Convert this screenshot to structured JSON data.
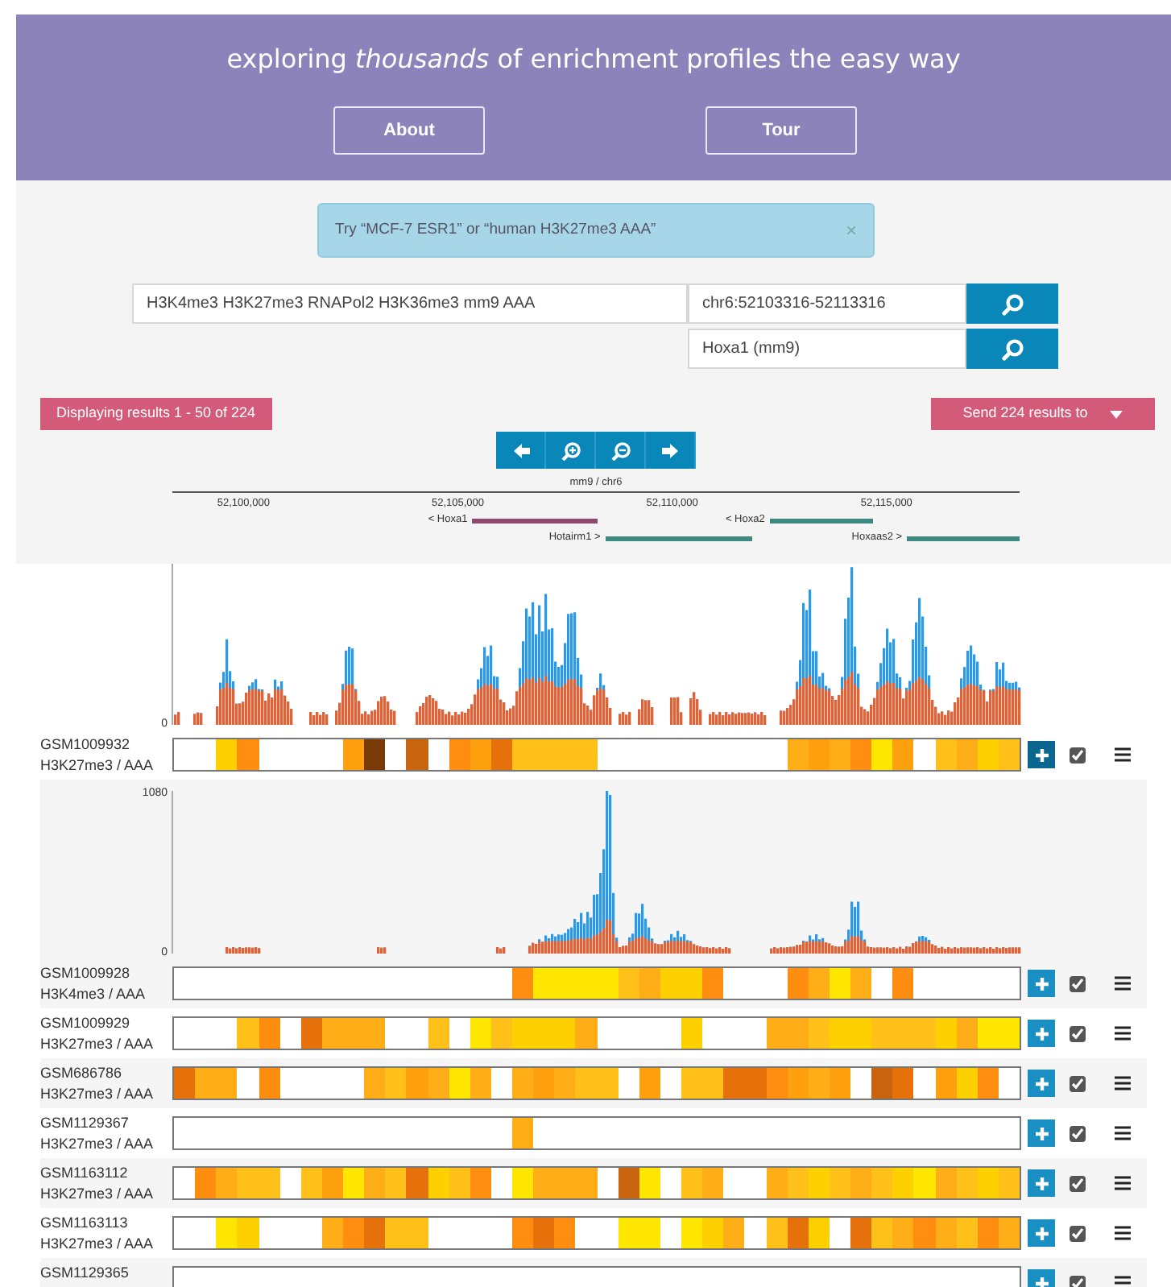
{
  "header": {
    "tagline": "exploring *thousands* of enrichment profiles the easy way",
    "buttons": [
      "About",
      "Tour"
    ]
  },
  "alert": {
    "text": "Try “MCF-7 ESR1” or “human H3K27me3 AAA”",
    "close": "×"
  },
  "search": {
    "query": "H3K4me3 H3K27me3 RNAPol2 H3K36me3 mm9 AAA",
    "location": "chr6:52103316-52113316",
    "gene": "Hoxa1 (mm9)"
  },
  "results_badge": "Displaying results 1 - 50 of 224",
  "send_button": "Send 224 results to",
  "genome_browser": {
    "assembly": "mm9 / chr6",
    "ticks": [
      "52,100,000",
      "52,105,000",
      "52,110,000",
      "52,115,000"
    ],
    "genes": [
      {
        "label": "< Hoxa1",
        "color": "#8b4a6e"
      },
      {
        "label": "< Hoxa2",
        "color": "#3f8a80"
      },
      {
        "label": "Hotairm1 >",
        "color": "#3f8a80"
      },
      {
        "label": "Hoxaas2 >",
        "color": "#3f8a80"
      }
    ]
  },
  "rows": [
    {
      "id": "GSM1009932",
      "mark": "H3K27me3 / AAA",
      "highlighted": true,
      "checked": true,
      "track": {
        "ymin": "0"
      },
      "cells": [
        null,
        null,
        {
          "color": "#ffd000"
        },
        {
          "color": "#ff8e10"
        },
        null,
        null,
        null,
        null,
        {
          "color": "#ffa00e"
        },
        {
          "color": "#7a3a08"
        },
        null,
        {
          "color": "#c8640e"
        },
        null,
        {
          "color": "#ff8e10"
        },
        {
          "color": "#ffa00e"
        },
        {
          "color": "#e6700a"
        },
        {
          "color": "#ffc01a"
        },
        {
          "color": "#ffc01a"
        },
        {
          "color": "#ffc01a"
        },
        {
          "color": "#ffc01a"
        },
        null,
        null,
        null,
        null,
        null,
        null,
        null,
        null,
        null,
        {
          "color": "#ffae18"
        },
        {
          "color": "#ffa00e"
        },
        {
          "color": "#ffae18"
        },
        {
          "color": "#ff8e10"
        },
        {
          "color": "#ffe600"
        },
        {
          "color": "#ffa00e"
        },
        null,
        {
          "color": "#ffc01a"
        },
        {
          "color": "#ffae18"
        },
        {
          "color": "#ffd000"
        },
        {
          "color": "#ffc01a"
        }
      ]
    },
    {
      "id": "GSM1009928",
      "mark": "H3K4me3 / AAA",
      "highlighted": false,
      "checked": true,
      "track": {
        "ymax": "1080",
        "ymin": "0"
      },
      "cells": [
        null,
        null,
        null,
        null,
        null,
        null,
        null,
        null,
        null,
        null,
        null,
        null,
        null,
        null,
        null,
        null,
        {
          "color": "#ff8e10"
        },
        {
          "color": "#ffe600"
        },
        {
          "color": "#ffe600"
        },
        {
          "color": "#ffe600"
        },
        {
          "color": "#ffe600"
        },
        {
          "color": "#ffc01a"
        },
        {
          "color": "#ffae18"
        },
        {
          "color": "#ffd000"
        },
        {
          "color": "#ffd000"
        },
        {
          "color": "#ff8e10"
        },
        null,
        null,
        null,
        {
          "color": "#ff8e10"
        },
        {
          "color": "#ffae18"
        },
        {
          "color": "#ffe600"
        },
        {
          "color": "#ffae18"
        },
        null,
        {
          "color": "#ff8e10"
        },
        null,
        null,
        null,
        null,
        null
      ]
    },
    {
      "id": "GSM1009929",
      "mark": "H3K27me3 / AAA",
      "highlighted": false,
      "checked": true,
      "cells": [
        null,
        null,
        null,
        {
          "color": "#ffc01a"
        },
        {
          "color": "#ff8e10"
        },
        null,
        {
          "color": "#e6700a"
        },
        {
          "color": "#ffae18"
        },
        {
          "color": "#ffae18"
        },
        {
          "color": "#ffae18"
        },
        null,
        null,
        {
          "color": "#ffc01a"
        },
        null,
        {
          "color": "#ffe600"
        },
        {
          "color": "#ffc01a"
        },
        {
          "color": "#ffd000"
        },
        {
          "color": "#ffd000"
        },
        {
          "color": "#ffd000"
        },
        {
          "color": "#ffae18"
        },
        null,
        null,
        null,
        null,
        {
          "color": "#ffd000"
        },
        null,
        null,
        null,
        {
          "color": "#ffae18"
        },
        {
          "color": "#ffae18"
        },
        {
          "color": "#ffc01a"
        },
        {
          "color": "#ffd000"
        },
        {
          "color": "#ffd000"
        },
        {
          "color": "#ffc01a"
        },
        {
          "color": "#ffc01a"
        },
        {
          "color": "#ffc01a"
        },
        {
          "color": "#ffd000"
        },
        {
          "color": "#ffae18"
        },
        {
          "color": "#ffe600"
        },
        {
          "color": "#ffe600"
        }
      ]
    },
    {
      "id": "GSM686786",
      "mark": "H3K27me3 / AAA",
      "highlighted": false,
      "checked": true,
      "cells": [
        {
          "color": "#e6700a"
        },
        {
          "color": "#ffae18"
        },
        {
          "color": "#ffae18"
        },
        null,
        {
          "color": "#ff8e10"
        },
        null,
        null,
        null,
        null,
        {
          "color": "#ffae18"
        },
        {
          "color": "#ffc01a"
        },
        {
          "color": "#ffa00e"
        },
        {
          "color": "#ffae18"
        },
        {
          "color": "#ffe600"
        },
        {
          "color": "#ffae18"
        },
        null,
        {
          "color": "#ffae18"
        },
        {
          "color": "#ffa00e"
        },
        {
          "color": "#ffae18"
        },
        {
          "color": "#ffc01a"
        },
        {
          "color": "#ffc01a"
        },
        null,
        {
          "color": "#ffa00e"
        },
        null,
        {
          "color": "#ffc01a"
        },
        {
          "color": "#ffc01a"
        },
        {
          "color": "#e6700a"
        },
        {
          "color": "#e6700a"
        },
        {
          "color": "#ff8e10"
        },
        {
          "color": "#ffa00e"
        },
        {
          "color": "#ffae18"
        },
        {
          "color": "#ffa00e"
        },
        null,
        {
          "color": "#c8640e"
        },
        {
          "color": "#e6700a"
        },
        null,
        {
          "color": "#ffa00e"
        },
        {
          "color": "#ffd000"
        },
        {
          "color": "#ff8e10"
        },
        null
      ]
    },
    {
      "id": "GSM1129367",
      "mark": "H3K27me3 / AAA",
      "highlighted": false,
      "checked": true,
      "cells": [
        null,
        null,
        null,
        null,
        null,
        null,
        null,
        null,
        null,
        null,
        null,
        null,
        null,
        null,
        null,
        null,
        {
          "color": "#ffae18"
        },
        null,
        null,
        null,
        null,
        null,
        null,
        null,
        null,
        null,
        null,
        null,
        null,
        null,
        null,
        null,
        null,
        null,
        null,
        null,
        null,
        null,
        null,
        null
      ]
    },
    {
      "id": "GSM1163112",
      "mark": "H3K27me3 / AAA",
      "highlighted": false,
      "checked": true,
      "cells": [
        null,
        {
          "color": "#ff8e10"
        },
        {
          "color": "#ffae18"
        },
        {
          "color": "#ffc01a"
        },
        {
          "color": "#ffc01a"
        },
        null,
        {
          "color": "#ffc01a"
        },
        {
          "color": "#ffa00e"
        },
        {
          "color": "#ffe600"
        },
        {
          "color": "#ffae18"
        },
        {
          "color": "#ffc01a"
        },
        {
          "color": "#e6700a"
        },
        {
          "color": "#ffd000"
        },
        {
          "color": "#ffc01a"
        },
        {
          "color": "#ff8e10"
        },
        null,
        {
          "color": "#ffe600"
        },
        {
          "color": "#ffae18"
        },
        {
          "color": "#ffae18"
        },
        {
          "color": "#ffae18"
        },
        null,
        {
          "color": "#c8640e"
        },
        {
          "color": "#ffe600"
        },
        null,
        {
          "color": "#ffc01a"
        },
        {
          "color": "#ffae18"
        },
        null,
        null,
        {
          "color": "#ffae18"
        },
        {
          "color": "#ffc01a"
        },
        {
          "color": "#ffd000"
        },
        {
          "color": "#ffc01a"
        },
        {
          "color": "#ffae18"
        },
        {
          "color": "#ffc01a"
        },
        {
          "color": "#ffd000"
        },
        {
          "color": "#ffe600"
        },
        {
          "color": "#ffae18"
        },
        {
          "color": "#ffc01a"
        },
        {
          "color": "#ffd000"
        },
        {
          "color": "#ffc01a"
        }
      ]
    },
    {
      "id": "GSM1163113",
      "mark": "H3K27me3 / AAA",
      "highlighted": false,
      "checked": true,
      "cells": [
        null,
        null,
        {
          "color": "#ffe600"
        },
        {
          "color": "#ffd000"
        },
        null,
        null,
        null,
        {
          "color": "#ffae18"
        },
        {
          "color": "#ff8e10"
        },
        {
          "color": "#e6700a"
        },
        {
          "color": "#ffc01a"
        },
        {
          "color": "#ffc01a"
        },
        null,
        null,
        null,
        null,
        {
          "color": "#ff8e10"
        },
        {
          "color": "#e6700a"
        },
        {
          "color": "#ff8e10"
        },
        null,
        null,
        {
          "color": "#ffe600"
        },
        {
          "color": "#ffe600"
        },
        null,
        {
          "color": "#ffe600"
        },
        {
          "color": "#ffd000"
        },
        {
          "color": "#ffae18"
        },
        null,
        {
          "color": "#ffc01a"
        },
        {
          "color": "#e6700a"
        },
        {
          "color": "#ffd000"
        },
        null,
        {
          "color": "#e6700a"
        },
        {
          "color": "#ffc01a"
        },
        {
          "color": "#ffae18"
        },
        {
          "color": "#ff8e10"
        },
        {
          "color": "#ffae18"
        },
        {
          "color": "#ffc01a"
        },
        {
          "color": "#ff8e10"
        },
        {
          "color": "#ffae18"
        }
      ]
    },
    {
      "id": "GSM1129365",
      "highlighted": false,
      "checked": true
    }
  ]
}
